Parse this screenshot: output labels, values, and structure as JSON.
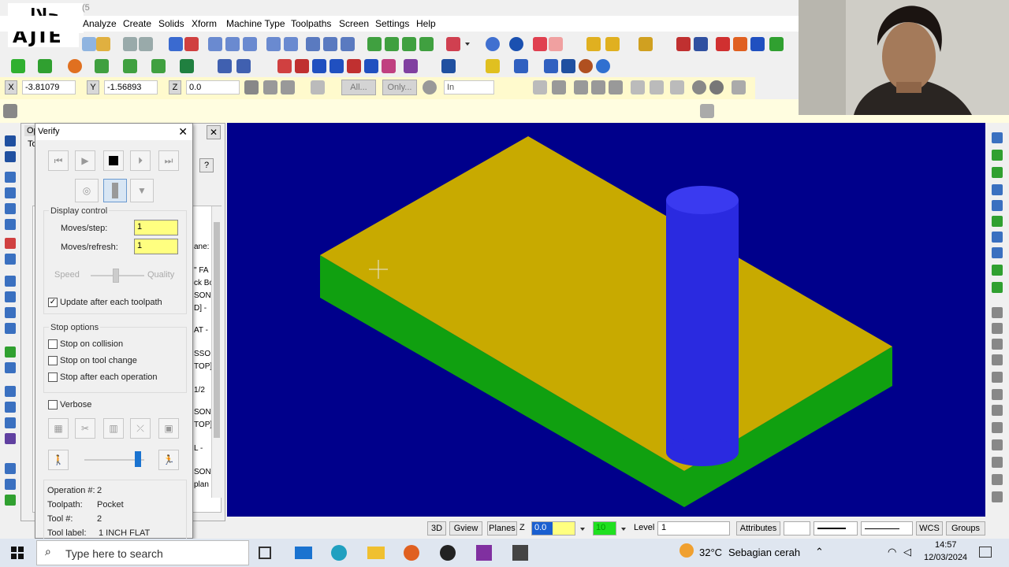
{
  "logo": {
    "arabic": "حلال",
    "name": "AJIE"
  },
  "window": {
    "title_fragment": "(5"
  },
  "menu": [
    "Analyze",
    "Create",
    "Solids",
    "Xform",
    "Machine Type",
    "Toolpaths",
    "Screen",
    "Settings",
    "Help"
  ],
  "coords": {
    "x_label": "X",
    "x_value": "-3.81079",
    "y_label": "Y",
    "y_value": "-1.56893",
    "z_label": "Z",
    "z_value": "0.0",
    "all_label": "All...",
    "only_label": "Only...",
    "mask_value": "In"
  },
  "verify": {
    "title": "Verify",
    "display_control": {
      "label": "Display control",
      "moves_step_label": "Moves/step:",
      "moves_step_value": "1",
      "moves_refresh_label": "Moves/refresh:",
      "moves_refresh_value": "1",
      "speed_label": "Speed",
      "quality_label": "Quality",
      "update_label": "Update after each toolpath",
      "update_checked": true
    },
    "stop_options": {
      "label": "Stop options",
      "collision_label": "Stop on collision",
      "tool_change_label": "Stop on tool change",
      "each_op_label": "Stop after each operation"
    },
    "verbose_label": "Verbose",
    "info": {
      "operation_label": "Operation #:",
      "operation_value": "2",
      "toolpath_label": "Toolpath:",
      "toolpath_value": "Pocket",
      "tool_label": "Tool #:",
      "tool_value": "2",
      "tool_name_label": "Tool label:",
      "tool_name_value": "1 INCH FLAT"
    }
  },
  "bg_panel": {
    "tab_op": "Op",
    "tab_to": "To",
    "fragments": [
      "ane:",
      "\" FA",
      "ck Bo",
      "SON",
      "D] -",
      "AT -",
      "SSO",
      "TOP]",
      "1/2",
      "SON",
      "TOP]",
      "L -",
      "SON",
      "plan"
    ]
  },
  "status": {
    "view_3d": "3D",
    "gview": "Gview",
    "planes": "Planes",
    "z_label": "Z",
    "z_value": "0.0",
    "color_value": "10",
    "level_label": "Level",
    "level_value": "1",
    "attributes": "Attributes",
    "wcs": "WCS",
    "groups": "Groups"
  },
  "taskbar": {
    "search_placeholder": "Type here to search",
    "weather_temp": "32°C",
    "weather_text": "Sebagian cerah",
    "time": "14:57",
    "date": "12/03/2024"
  },
  "colors": {
    "viewport": "#00008b",
    "stock_top": "#c8aa00",
    "stock_side": "#10a010",
    "tool": "#2a2ae0",
    "input_yellow": "#ffff80"
  }
}
